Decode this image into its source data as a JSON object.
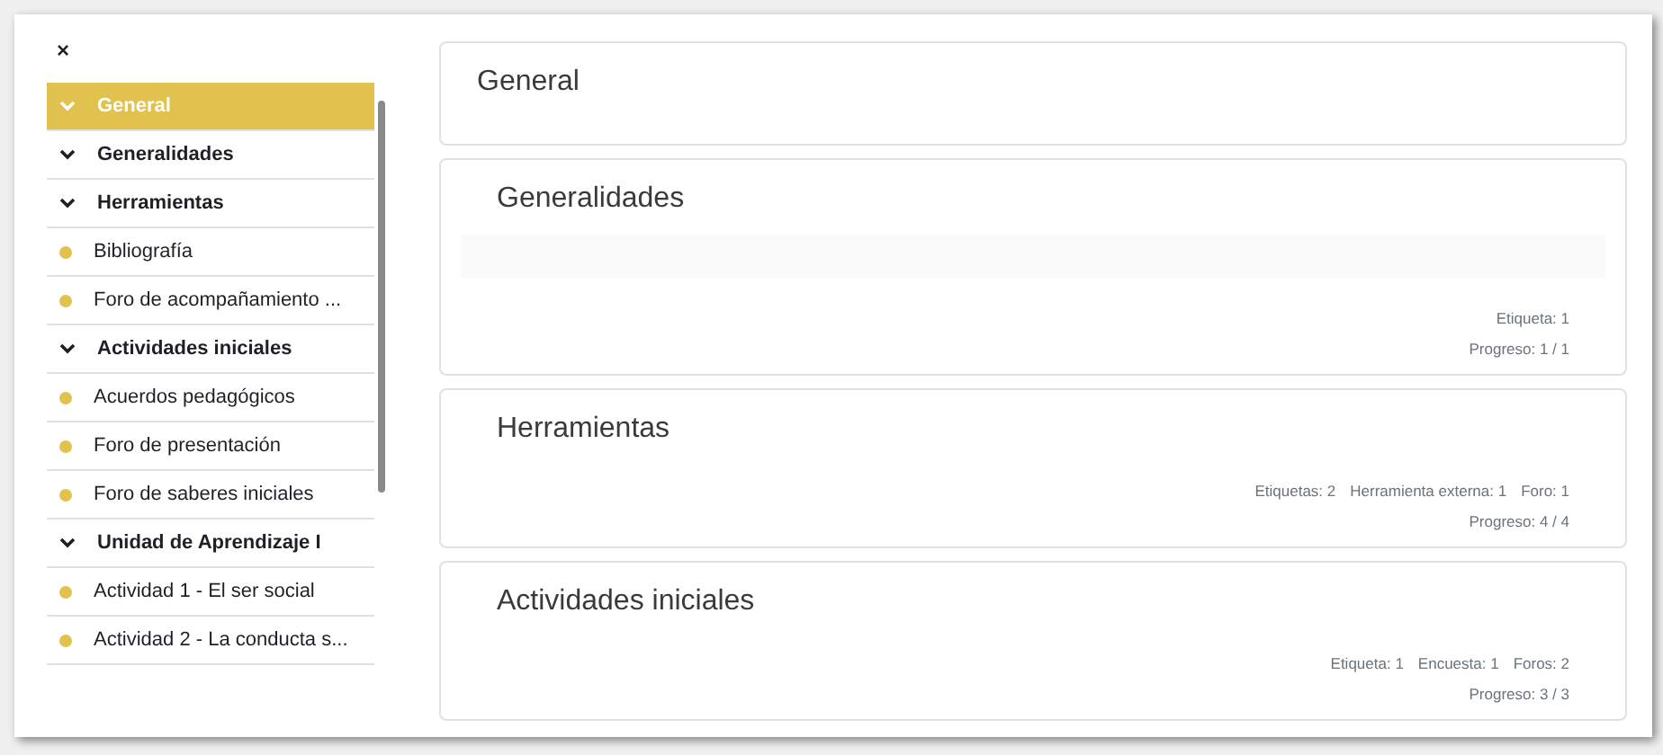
{
  "sidebar": {
    "close": "×",
    "items": [
      {
        "kind": "section",
        "label": "General",
        "selected": true
      },
      {
        "kind": "section",
        "label": "Generalidades",
        "selected": false
      },
      {
        "kind": "section",
        "label": "Herramientas",
        "selected": false
      },
      {
        "kind": "activity",
        "label": "Bibliografía",
        "selected": false
      },
      {
        "kind": "activity",
        "label": "Foro de acompañamiento ...",
        "selected": false
      },
      {
        "kind": "section",
        "label": "Actividades iniciales",
        "selected": false
      },
      {
        "kind": "activity",
        "label": "Acuerdos pedagógicos",
        "selected": false
      },
      {
        "kind": "activity",
        "label": "Foro de presentación",
        "selected": false
      },
      {
        "kind": "activity",
        "label": "Foro de saberes iniciales",
        "selected": false
      },
      {
        "kind": "section",
        "label": "Unidad de Aprendizaje I",
        "selected": false
      },
      {
        "kind": "activity",
        "label": "Actividad 1 - El ser social",
        "selected": false
      },
      {
        "kind": "activity",
        "label": "Actividad 2 - La conducta s...",
        "selected": false
      }
    ]
  },
  "sections": [
    {
      "title": "General"
    },
    {
      "title": "Generalidades",
      "summary": true,
      "counts": [
        "Etiqueta: 1"
      ],
      "progress": "Progreso: 1 / 1"
    },
    {
      "title": "Herramientas",
      "summary": false,
      "counts": [
        "Etiquetas: 2",
        "Herramienta externa: 1",
        "Foro: 1"
      ],
      "progress": "Progreso: 4 / 4"
    },
    {
      "title": "Actividades iniciales",
      "summary": false,
      "counts": [
        "Etiqueta: 1",
        "Encuesta: 1",
        "Foros: 2"
      ],
      "progress": "Progreso: 3 / 3"
    }
  ]
}
